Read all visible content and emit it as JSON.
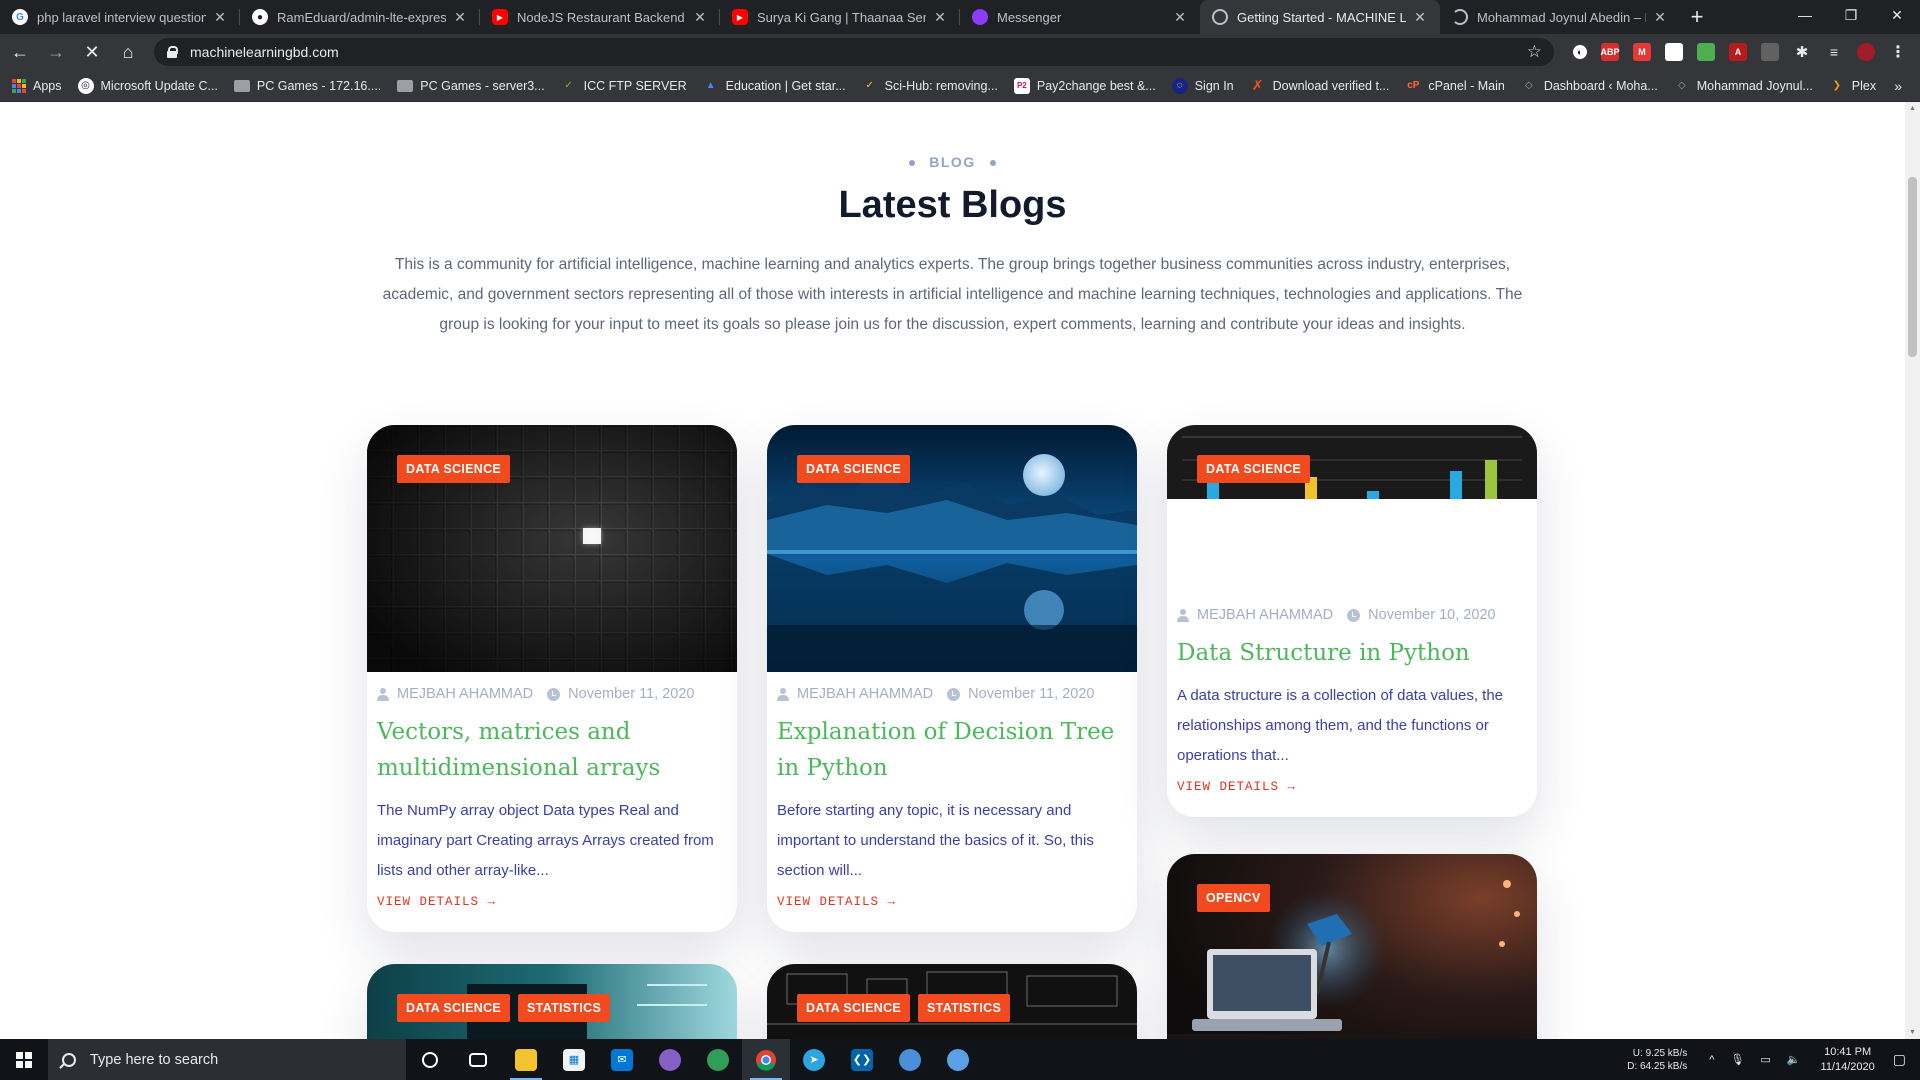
{
  "browser": {
    "tabs": [
      {
        "title": "php laravel interview questions -",
        "icon": "google-icon",
        "color": "#ffffff",
        "active": false
      },
      {
        "title": "RamEduard/admin-lte-express: A",
        "icon": "github-icon",
        "color": "#ffffff",
        "active": false
      },
      {
        "title": "NodeJS Restaurant Backend | Ad",
        "icon": "youtube-icon",
        "color": "#ff0000",
        "active": false
      },
      {
        "title": "Surya Ki Gang | Thaanaa Serndha",
        "icon": "youtube-icon",
        "color": "#ff0000",
        "active": false
      },
      {
        "title": "Messenger",
        "icon": "messenger-icon",
        "color": "#a033ff",
        "active": false
      },
      {
        "title": "Getting Started - MACHINE LEAR",
        "icon": "globe-icon",
        "color": "#bdc1c6",
        "active": true
      },
      {
        "title": "Mohammad Joynul Abedin – Pers",
        "icon": "loading-icon",
        "color": "#bdc1c6",
        "active": false
      }
    ],
    "url": "machinelearningbd.com",
    "bookmarks": [
      {
        "label": "Apps",
        "icon": "apps-icon"
      },
      {
        "label": "Microsoft Update C...",
        "icon": "microsoft-update-icon"
      },
      {
        "label": "PC Games - 172.16....",
        "icon": "folder-icon"
      },
      {
        "label": "PC Games - server3...",
        "icon": "folder-icon"
      },
      {
        "label": "ICC FTP SERVER",
        "icon": "ftp-icon"
      },
      {
        "label": "Education | Get star...",
        "icon": "education-icon"
      },
      {
        "label": "Sci-Hub: removing...",
        "icon": "scihub-icon"
      },
      {
        "label": "Pay2change best &...",
        "icon": "pay2change-icon"
      },
      {
        "label": "Sign In",
        "icon": "signin-icon"
      },
      {
        "label": "Download verified t...",
        "icon": "download-icon"
      },
      {
        "label": "cPanel - Main",
        "icon": "cpanel-icon"
      },
      {
        "label": "Dashboard ‹ Moha...",
        "icon": "wordpress-icon"
      },
      {
        "label": "Mohammad Joynul...",
        "icon": "wordpress-icon"
      },
      {
        "label": "Plex",
        "icon": "plex-icon"
      }
    ]
  },
  "section": {
    "eyebrow": "BLOG",
    "title": "Latest Blogs",
    "description": "This is a community for artificial intelligence, machine learning and analytics experts. The group brings together business communities across industry, enterprises, academic, and government sectors representing all of those with interests in artificial intelligence and machine learning techniques, technologies and applications. The group is looking for your input to meet its goals so please join us for the discussion, expert comments, learning and contribute your ideas and insights."
  },
  "cards": [
    {
      "tags": [
        "DATA SCIENCE"
      ],
      "author": "MEJBAH AHAMMAD",
      "date": "November 11, 2020",
      "title": "Vectors, matrices and multidimensional arrays",
      "excerpt": "The NumPy array object Data types Real and imaginary part Creating arrays Arrays created from lists and other array-like...",
      "link": "VIEW DETAILS →"
    },
    {
      "tags": [
        "DATA SCIENCE"
      ],
      "author": "MEJBAH AHAMMAD",
      "date": "November 11, 2020",
      "title": "Explanation of Decision Tree in Python",
      "excerpt": "Before starting any topic, it is necessary and important to understand the basics of it. So, this section will...",
      "link": "VIEW DETAILS →"
    },
    {
      "tags": [
        "DATA SCIENCE"
      ],
      "author": "MEJBAH AHAMMAD",
      "date": "November 10, 2020",
      "title": "Data Structure in Python",
      "excerpt": "A data structure is a collection of data values, the relationships among them, and the functions or operations that...",
      "link": "VIEW DETAILS →"
    },
    {
      "tags": [
        "OPENCV"
      ]
    },
    {
      "tags": [
        "DATA SCIENCE",
        "STATISTICS"
      ]
    },
    {
      "tags": [
        "DATA SCIENCE",
        "STATISTICS"
      ]
    }
  ],
  "taskbar": {
    "search_placeholder": "Type here to search",
    "apps": [
      "task-view-icon",
      "file-explorer-icon",
      "store-icon",
      "mail-icon",
      "app-icon",
      "edge-icon",
      "chrome-icon",
      "telegram-icon",
      "vscode-icon",
      "app-icon",
      "app-icon"
    ],
    "net_up_label": "U:",
    "net_down_label": "D:",
    "net_up": "9.25 kB/s",
    "net_down": "64.25 kB/s",
    "time": "10:41 PM",
    "date": "11/14/2020"
  },
  "colors": {
    "accent_badge": "#f24a1f",
    "title_green": "#4cb85c",
    "excerpt_blue": "#3a3ea8",
    "link_red": "#e0321b"
  }
}
